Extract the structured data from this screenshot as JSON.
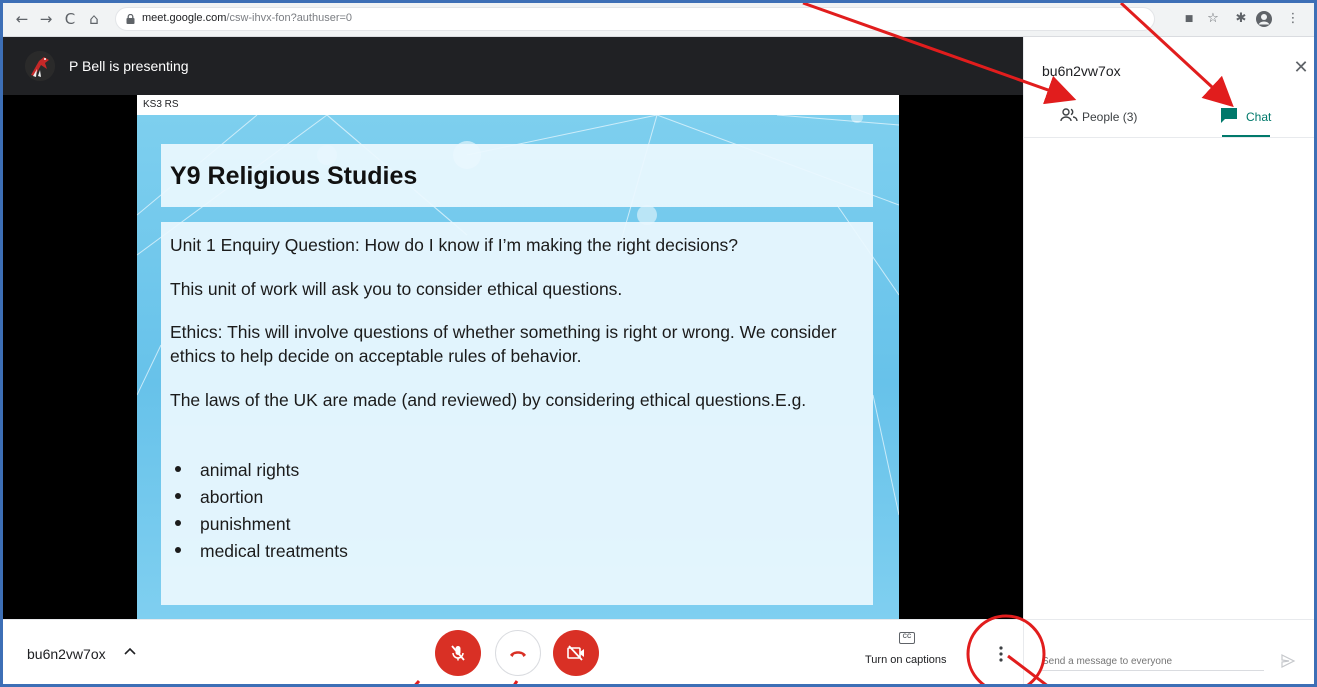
{
  "browser": {
    "url_host": "meet.google.com",
    "url_path": "/csw-ihvx-fon?authuser=0",
    "back_glyph": "←",
    "forward_glyph": "→",
    "reload_glyph": "C",
    "home_glyph": "⌂",
    "ext_camera_glyph": "■",
    "ext_star_glyph": "☆",
    "ext_puzzle_glyph": "✱",
    "ext_menu_glyph": "⋮"
  },
  "presenter": {
    "label": "P Bell is presenting"
  },
  "slide": {
    "header": "KS3 RS",
    "title": "Y9 Religious Studies",
    "paragraphs": [
      "Unit 1 Enquiry Question: How do I know if I’m making the right decisions?",
      "This unit of work will ask you to consider ethical questions.",
      "Ethics: This will involve questions of whether something is right or wrong. We consider ethics to help decide on acceptable rules of behavior.",
      "The laws of the UK are made (and reviewed) by considering ethical questions.E.g."
    ],
    "bullets": [
      "animal rights",
      "abortion",
      "punishment",
      "medical treatments"
    ]
  },
  "panel": {
    "title": "bu6n2vw7ox",
    "close_glyph": "✕",
    "tab_people": "People (3)",
    "tab_chat": "Chat"
  },
  "bottom": {
    "meeting_code": "bu6n2vw7ox",
    "captions_icon_text": "CC",
    "captions_label": "Turn on captions",
    "chat_placeholder": "Send a message to everyone"
  },
  "colors": {
    "mute_red": "#d93025",
    "accent_teal": "#00796b",
    "annotation_red": "#e11d1d"
  }
}
